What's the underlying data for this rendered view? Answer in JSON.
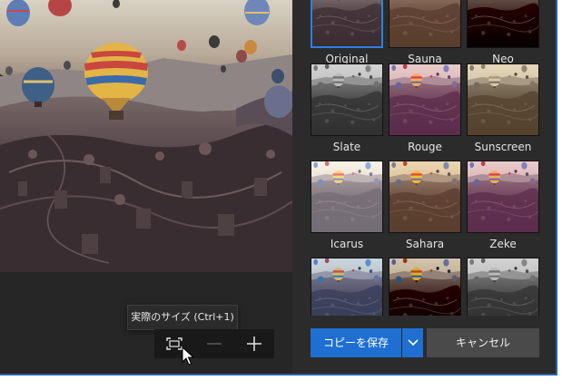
{
  "tooltip": {
    "text": "実際のサイズ (Ctrl+1)"
  },
  "zoom": {
    "actual_size_icon": "fit-screen-icon",
    "zoom_out_icon": "minus-icon",
    "zoom_in_icon": "plus-icon"
  },
  "filters": [
    {
      "label": "Original",
      "selected": true
    },
    {
      "label": "Sauna"
    },
    {
      "label": "Neo"
    },
    {
      "label": "Slate"
    },
    {
      "label": "Rouge"
    },
    {
      "label": "Sunscreen"
    },
    {
      "label": "Icarus"
    },
    {
      "label": "Sahara"
    },
    {
      "label": "Zeke"
    },
    {
      "label": ""
    },
    {
      "label": ""
    },
    {
      "label": ""
    }
  ],
  "actions": {
    "save_label": "コピーを保存",
    "save_dropdown_icon": "chevron-down-icon",
    "cancel_label": "キャンセル"
  },
  "colors": {
    "accent": "#1e6fd1",
    "panel": "#2b2b2b",
    "background": "#1f1f1f"
  }
}
